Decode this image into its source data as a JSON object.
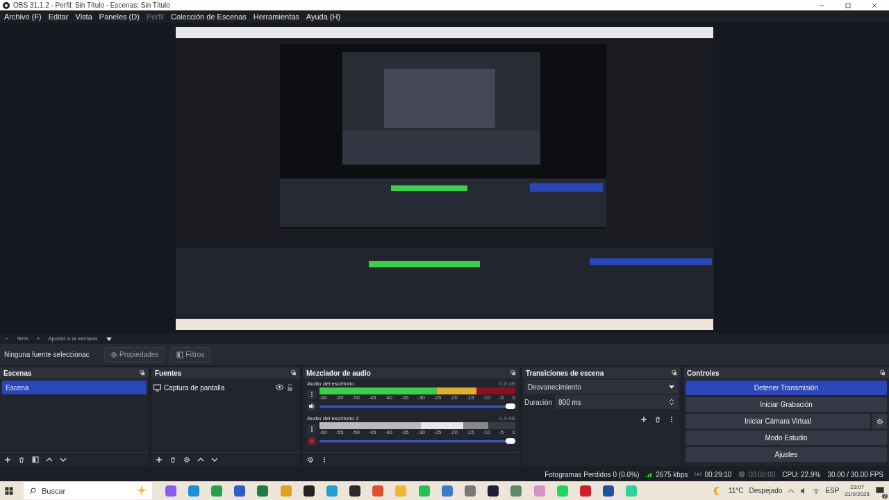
{
  "window": {
    "title": "OBS 31.1.2 - Perfil: Sin Título - Escenas: Sin Título"
  },
  "menu": [
    {
      "label": "Archivo (F)",
      "disabled": false
    },
    {
      "label": "Editar",
      "disabled": false
    },
    {
      "label": "Vista",
      "disabled": false
    },
    {
      "label": "Paneles (D)",
      "disabled": false
    },
    {
      "label": "Perfil",
      "disabled": true
    },
    {
      "label": "Colección de Escenas",
      "disabled": false
    },
    {
      "label": "Herramientas",
      "disabled": false
    },
    {
      "label": "Ayuda (H)",
      "disabled": false
    }
  ],
  "zoom_bar": {
    "minus": "−",
    "zoom": "90%",
    "plus": "+",
    "fit": "Ajustar a la ventana"
  },
  "source_toolbar": {
    "label": "Ninguna fuente seleccionac",
    "buttons": [
      "Propiedades",
      "Filtros"
    ]
  },
  "scenes": {
    "title": "Escenas",
    "items": [
      {
        "label": "Escena",
        "selected": true
      }
    ]
  },
  "sources": {
    "title": "Fuentes",
    "items": [
      {
        "label": "Captura de pantalla",
        "visible": true,
        "locked": false
      }
    ]
  },
  "mixer": {
    "title": "Mezclador de audio",
    "channels": [
      {
        "name": "Audio del escritorio",
        "reading": "0.0 dB",
        "meter": {
          "level": 1
        },
        "ticks": [
          "-60",
          "-55",
          "-50",
          "-45",
          "-40",
          "-35",
          "-30",
          "-25",
          "-20",
          "-15",
          "-10",
          "-5",
          "0"
        ],
        "volume": {
          "level": 1
        },
        "muted": false
      },
      {
        "name": "Audio del escritorio 2",
        "reading": "0.0 dB",
        "meter": {
          "level": 0.86
        },
        "ticks": [
          "-60",
          "-55",
          "-50",
          "-45",
          "-40",
          "-35",
          "-30",
          "-25",
          "-20",
          "-15",
          "-10",
          "-5",
          "0"
        ],
        "volume": {
          "level": 1
        },
        "muted": true
      }
    ]
  },
  "transitions": {
    "title": "Transiciones de escena",
    "selected": "Desvanecimiento",
    "duration_label": "Duración",
    "duration": "800 ms"
  },
  "controls": {
    "title": "Controles",
    "buttons": [
      {
        "label": "Detener Transmisión",
        "selected": true,
        "settings": false
      },
      {
        "label": "Iniciar Grabación",
        "selected": false,
        "settings": false
      },
      {
        "label": "Iniciar Cámara Virtual",
        "selected": false,
        "settings": true
      },
      {
        "label": "Modo Estudio",
        "selected": false,
        "settings": false
      },
      {
        "label": "Ajustes",
        "selected": false,
        "settings": false
      }
    ]
  },
  "status_bar": {
    "dropped": "Fotogramas Perdidos 0 (0.0%)",
    "bitrate": "2675 kbps",
    "stream_time": "00:29:10",
    "record_time": "00:00:00",
    "cpu": "CPU: 22.9%",
    "fps": "30.00 / 30.00 FPS"
  },
  "taskbar": {
    "search": "Buscar",
    "apps": [
      {
        "color": "#8a5cf0"
      },
      {
        "color": "#1b8fd8"
      },
      {
        "color": "#2aa04a"
      },
      {
        "color": "#2b5fc4"
      },
      {
        "color": "#1f7a45"
      },
      {
        "color": "#e0a020"
      },
      {
        "color": "#222222"
      },
      {
        "color": "#21a0d8"
      },
      {
        "color": "#2a2a2a"
      },
      {
        "color": "#e05030"
      },
      {
        "color": "#f0b830"
      },
      {
        "color": "#25c05a"
      },
      {
        "color": "#3a7bd0"
      },
      {
        "color": "#777777"
      },
      {
        "color": "#1e1e3a"
      },
      {
        "color": "#5a8a6a"
      },
      {
        "color": "#d890c8"
      },
      {
        "color": "#1ed760"
      },
      {
        "color": "#d02030"
      },
      {
        "color": "#2050a0"
      },
      {
        "color": "#30d0a0"
      }
    ],
    "temperature": "11°C",
    "weather": "Despejado",
    "language": "ESP",
    "time": "23:07",
    "date": "21/9/2025",
    "notifications": "7"
  }
}
